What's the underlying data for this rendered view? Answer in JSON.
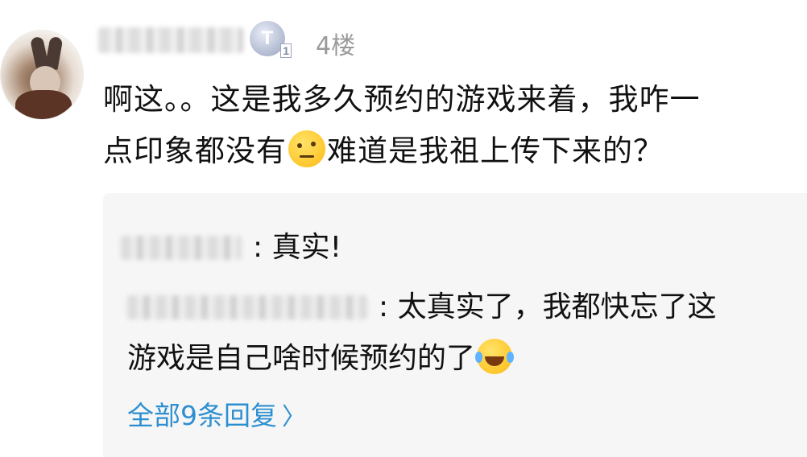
{
  "post": {
    "level_badge": "T",
    "level_badge_sub": "1",
    "floor": "4楼",
    "text_line1": "啊这。。这是我多久预约的游戏来着，我咋一",
    "text_line2_a": "点印象都没有",
    "text_line2_b": "难道是我祖上传下来的？",
    "emoji_1": "thinking-face-icon"
  },
  "replies": [
    {
      "text": ": 真实!"
    },
    {
      "text_a": ": 太真实了，我都快忘了这",
      "text_b": "游戏是自己啥时候预约的了",
      "emoji": "laughing-tears-icon"
    }
  ],
  "more_replies_label": "全部9条回复",
  "colors": {
    "link": "#2d8fd0",
    "muted": "#9a9a9a",
    "reply_bg": "#f6f6f6"
  }
}
